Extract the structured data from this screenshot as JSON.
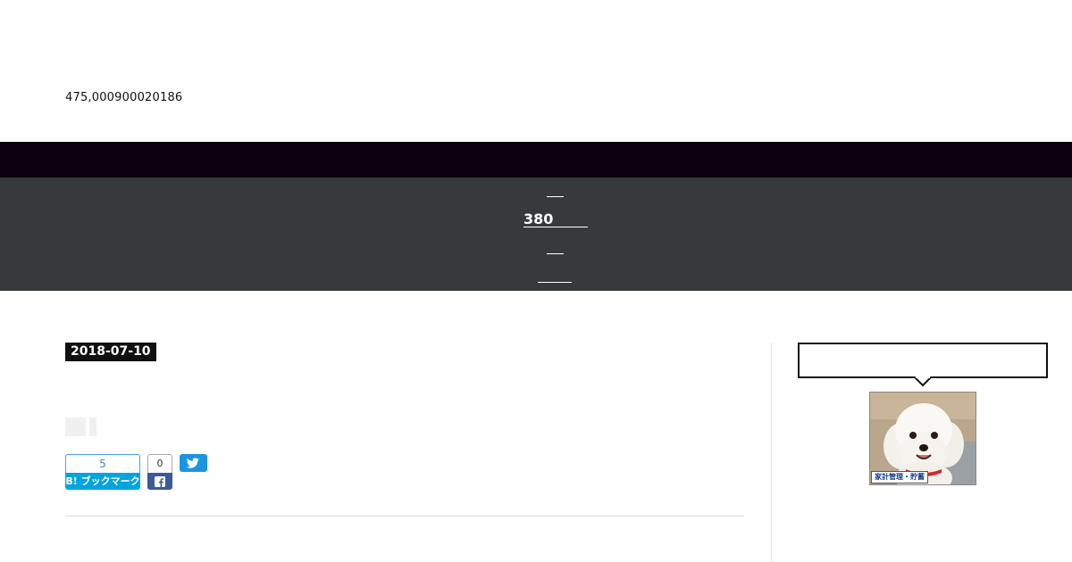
{
  "header": {
    "site_id": "475,000900020186"
  },
  "nav": {
    "main_label": "380"
  },
  "post": {
    "date": "2018-07-10"
  },
  "share": {
    "hatena_count": "5",
    "hatena_label": "B! ブックマーク",
    "facebook_count": "0"
  },
  "sidebar": {
    "photo_caption": "家計管理・貯蓄"
  },
  "colors": {
    "top_band": "#0c0010",
    "nav_band": "#373a3c",
    "hatena": "#00a4de",
    "facebook": "#3b5998",
    "twitter": "#1b95e0"
  },
  "icons": {
    "facebook": "facebook-icon",
    "twitter": "twitter-icon"
  }
}
